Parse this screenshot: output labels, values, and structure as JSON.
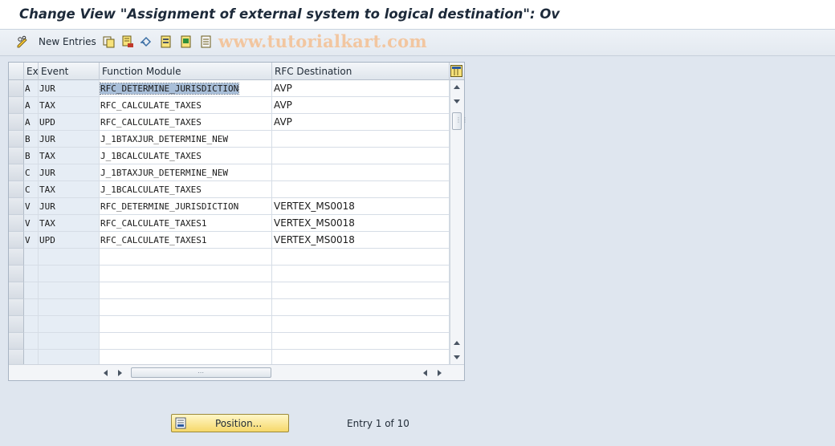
{
  "window": {
    "title": "Change View \"Assignment of external system to logical destination\": Ov"
  },
  "toolbar": {
    "new_entries_label": "New Entries",
    "icons": [
      "pencil-glasses-icon",
      "copy-icon",
      "delete-icon",
      "undo-icon",
      "select-all-icon",
      "select-block-icon",
      "deselect-all-icon"
    ]
  },
  "watermark": "www.tutorialkart.com",
  "table": {
    "columns": [
      "Ex",
      "Event",
      "Function Module",
      "RFC Destination"
    ],
    "rows": [
      {
        "ex": "A",
        "event": "JUR",
        "func": "RFC_DETERMINE_JURISDICTION",
        "dest": "AVP"
      },
      {
        "ex": "A",
        "event": "TAX",
        "func": "RFC_CALCULATE_TAXES",
        "dest": "AVP"
      },
      {
        "ex": "A",
        "event": "UPD",
        "func": "RFC_CALCULATE_TAXES",
        "dest": "AVP"
      },
      {
        "ex": "B",
        "event": "JUR",
        "func": "J_1BTAXJUR_DETERMINE_NEW",
        "dest": ""
      },
      {
        "ex": "B",
        "event": "TAX",
        "func": "J_1BCALCULATE_TAXES",
        "dest": ""
      },
      {
        "ex": "C",
        "event": "JUR",
        "func": "J_1BTAXJUR_DETERMINE_NEW",
        "dest": ""
      },
      {
        "ex": "C",
        "event": "TAX",
        "func": "J_1BCALCULATE_TAXES",
        "dest": ""
      },
      {
        "ex": "V",
        "event": "JUR",
        "func": "RFC_DETERMINE_JURISDICTION",
        "dest": "VERTEX_MS0018"
      },
      {
        "ex": "V",
        "event": "TAX",
        "func": "RFC_CALCULATE_TAXES1",
        "dest": "VERTEX_MS0018"
      },
      {
        "ex": "V",
        "event": "UPD",
        "func": "RFC_CALCULATE_TAXES1",
        "dest": "VERTEX_MS0018"
      }
    ],
    "empty_rows": 7
  },
  "footer": {
    "position_label": "Position...",
    "entry_text": "Entry 1 of 10"
  },
  "colors": {
    "key_cell": "#e6edf5",
    "selection": "#a9bfd9",
    "position_button": "#f6d86a"
  }
}
